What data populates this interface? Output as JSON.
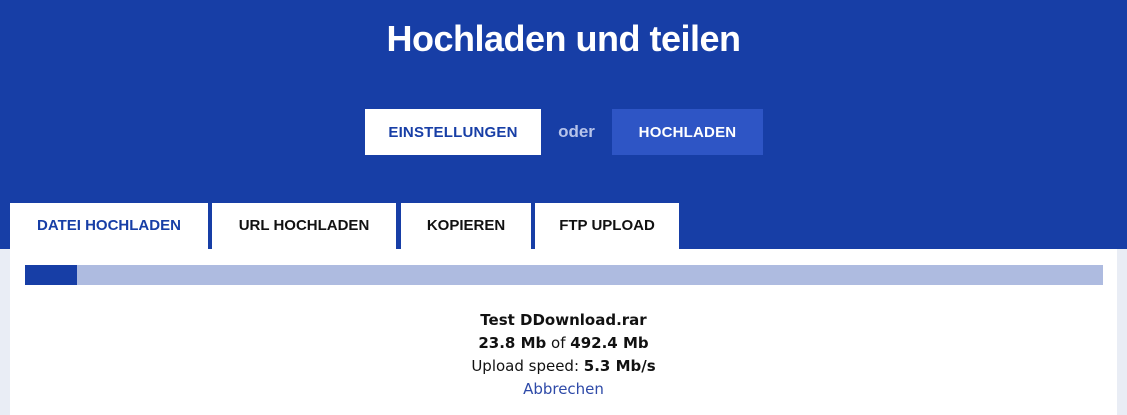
{
  "header": {
    "title": "Hochladen und teilen"
  },
  "actions": {
    "settings_label": "EINSTELLUNGEN",
    "or_label": "oder",
    "upload_label": "HOCHLADEN"
  },
  "tabs": [
    {
      "label": "DATEI HOCHLADEN",
      "active": true
    },
    {
      "label": "URL HOCHLADEN",
      "active": false
    },
    {
      "label": "KOPIEREN",
      "active": false
    },
    {
      "label": "FTP UPLOAD",
      "active": false
    }
  ],
  "upload": {
    "file_name": "Test DDownload.rar",
    "uploaded": "23.8 Mb",
    "of_label": "of",
    "total": "492.4 Mb",
    "speed_label": "Upload speed:",
    "speed": "5.3 Mb/s",
    "cancel_label": "Abbrechen",
    "progress_fraction": 0.0483
  },
  "colors": {
    "brand": "#173ea6",
    "upload_button": "#2e55c5",
    "progress_track": "#aebbe0",
    "link": "#2e4aa8"
  }
}
